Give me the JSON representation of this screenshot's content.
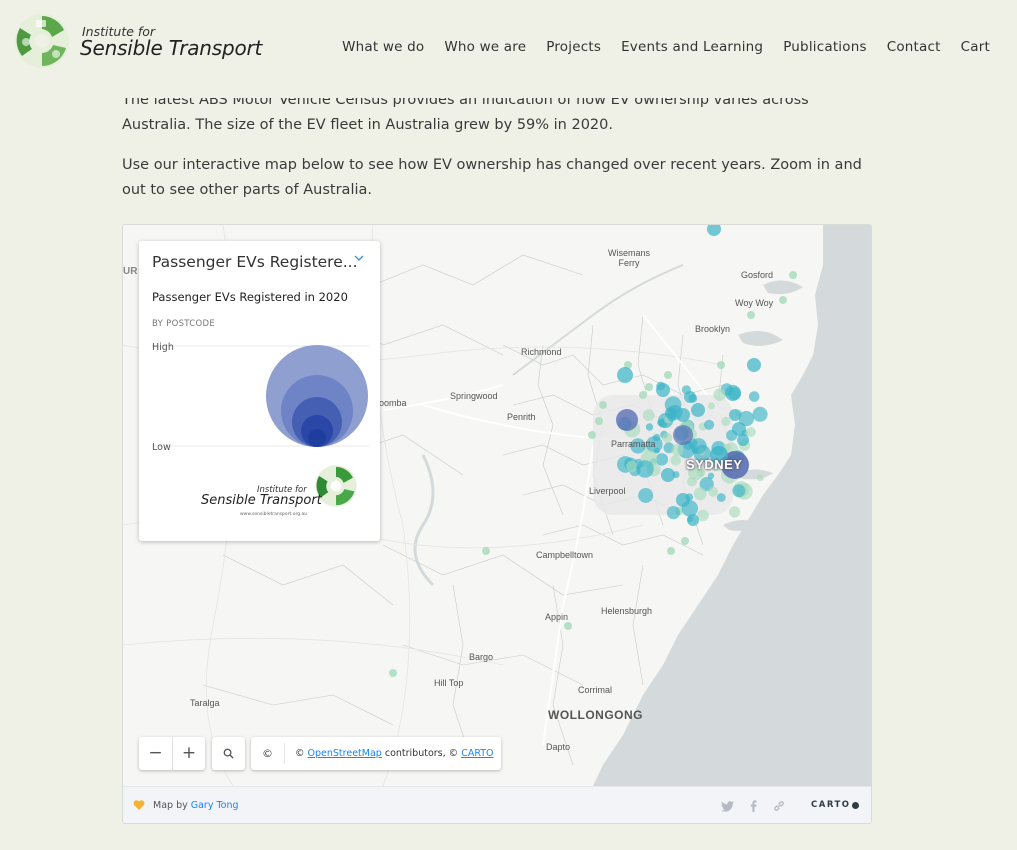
{
  "site": {
    "logo_small": "Institute for",
    "logo_big": "Sensible Transport",
    "brand_green": "#5aa84a"
  },
  "nav": [
    {
      "label": "What we do"
    },
    {
      "label": "Who we are"
    },
    {
      "label": "Projects"
    },
    {
      "label": "Events and Learning"
    },
    {
      "label": "Publications"
    },
    {
      "label": "Contact"
    },
    {
      "label": "Cart"
    }
  ],
  "content": {
    "para1": "The latest ABS Motor Vehicle Census provides an indication of how EV ownership varies across Australia. The size of the EV fleet in Australia grew by 59% in 2020.",
    "para2": "Use our interactive map below to see how EV ownership has changed over recent years. Zoom in and out to see other parts of Australia."
  },
  "map": {
    "legend": {
      "dropdown_label": "Passenger EVs Registere...",
      "title": "Passenger EVs Registered in 2020",
      "subtitle": "BY POSTCODE",
      "high_label": "High",
      "low_label": "Low",
      "logo_small": "Institute for",
      "logo_big": "Sensible Transport",
      "logo_url": "www.sensibletransport.org.au"
    },
    "places": {
      "wisemans_ferry": "Wisemans\nFerry",
      "gosford": "Gosford",
      "woy_woy": "Woy Woy",
      "brooklyn": "Brooklyn",
      "richmond": "Richmond",
      "springwood": "Springwood",
      "katoomba": "oomba",
      "penrith": "Penrith",
      "parramatta": "Parramatta",
      "sydney": "SYDNEY",
      "liverpool": "Liverpool",
      "campbelltown": "Campbelltown",
      "helensburgh": "Helensburgh",
      "appin": "Appin",
      "bargo": "Bargo",
      "hill_top": "Hill Top",
      "taralga": "Taralga",
      "corrimal": "Corrimal",
      "wollongong": "WOLLONGONG",
      "dapto": "Dapto",
      "edge_ur": "UR"
    },
    "controls": {
      "zoom_out": "−",
      "zoom_in": "+",
      "search_icon": "🔍"
    },
    "attribution": {
      "copy_symbol": "©",
      "prefix": "© ",
      "osm_link": "OpenStreetMap",
      "middle": " contributors, © ",
      "carto_link": "CARTO"
    },
    "footer": {
      "map_by": "Map by ",
      "author": "Gary Tong",
      "carto": "CARTO"
    },
    "colors": {
      "water": "#d4dadc",
      "bubble_teal": "#3bb3c8",
      "bubble_green": "#a9dcbd",
      "bubble_blue": "#5b70b5",
      "legend_dark": "#1f3d9e",
      "legend_light": "#8f9fd0"
    }
  }
}
